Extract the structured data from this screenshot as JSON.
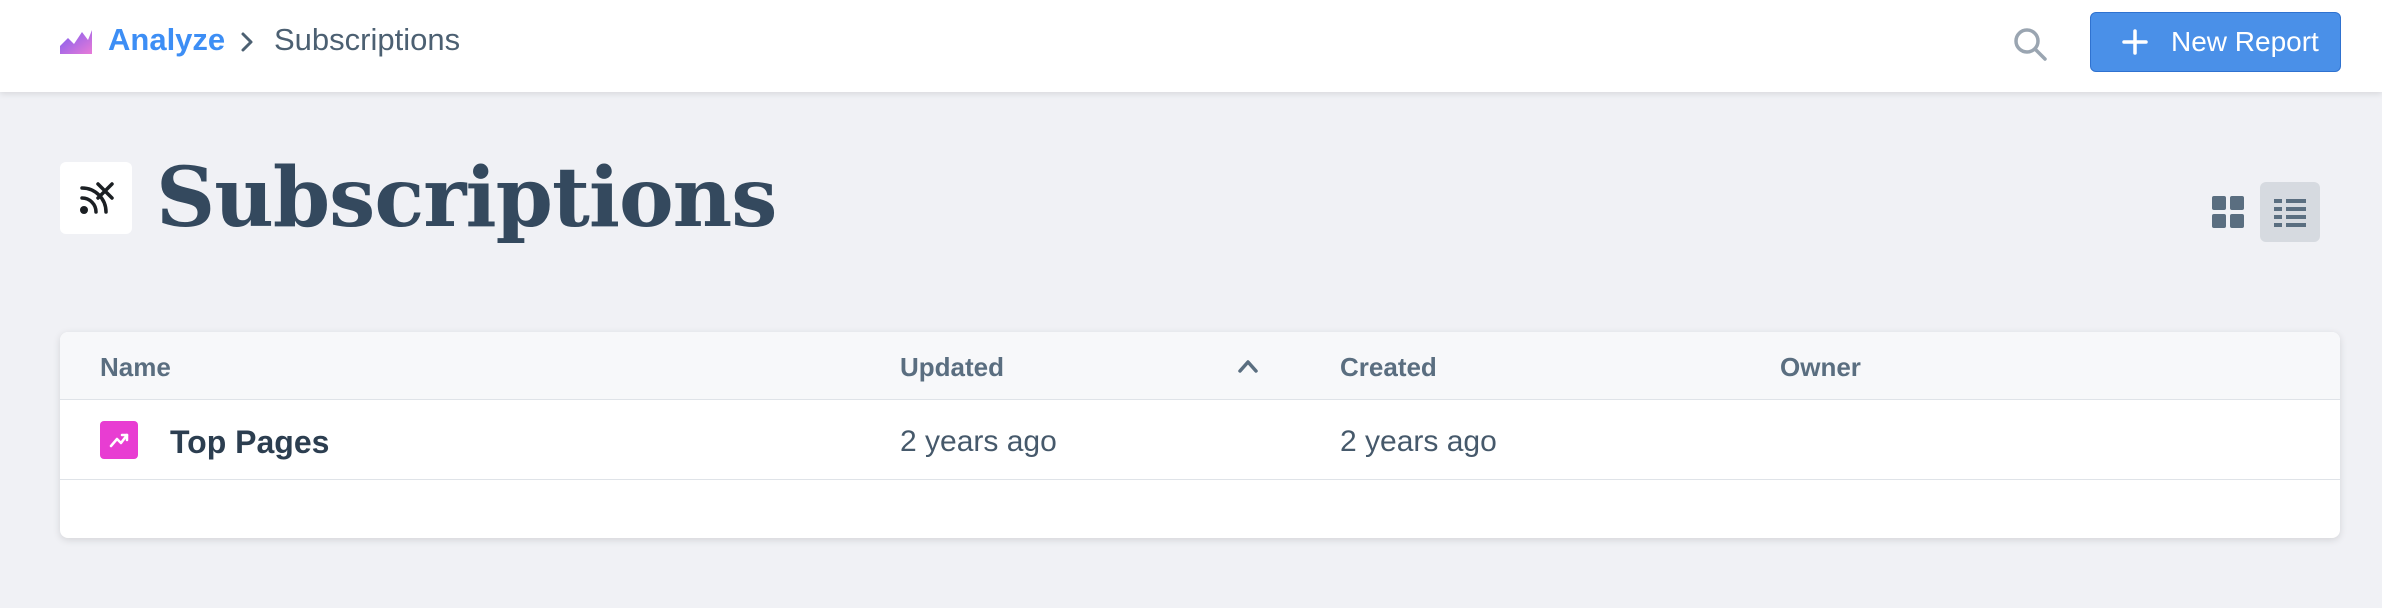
{
  "header": {
    "brand_icon": "analyze-chart-icon",
    "breadcrumb_root": "Analyze",
    "breadcrumb_current": "Subscriptions",
    "new_report_label": "New Report",
    "accent_color": "#4a90e8"
  },
  "page": {
    "title": "Subscriptions",
    "icon": "rss-feed-icon",
    "view_mode": "list"
  },
  "table": {
    "columns": [
      "Name",
      "Updated",
      "Created",
      "Owner"
    ],
    "sorted_by": "Updated",
    "sort_direction": "ascending",
    "rows": [
      {
        "name": "Top Pages",
        "icon": "trend-line-icon",
        "icon_color": "#e83dd2",
        "updated": "2 years ago",
        "created": "2 years ago",
        "owner": ""
      }
    ]
  }
}
